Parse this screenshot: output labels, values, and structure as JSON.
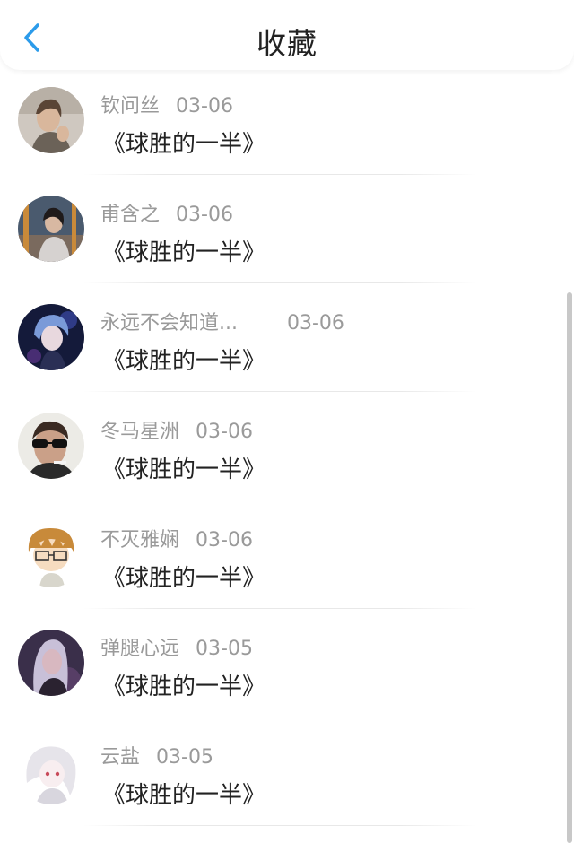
{
  "header": {
    "title": "收藏",
    "back_icon": "chevron-left-icon",
    "accent_color": "#2b9bea"
  },
  "items": [
    {
      "name": "钦问丝",
      "date": "03-06",
      "work": "《球胜的一半》"
    },
    {
      "name": "甫含之",
      "date": "03-06",
      "work": "《球胜的一半》"
    },
    {
      "name": "永远不会知道...",
      "date": "03-06",
      "work": "《球胜的一半》"
    },
    {
      "name": "冬马星洲",
      "date": "03-06",
      "work": "《球胜的一半》"
    },
    {
      "name": "不灭雅娴",
      "date": "03-06",
      "work": "《球胜的一半》"
    },
    {
      "name": "弹腿心远",
      "date": "03-05",
      "work": "《球胜的一半》"
    },
    {
      "name": "云盐",
      "date": "03-05",
      "work": "《球胜的一半》"
    }
  ]
}
